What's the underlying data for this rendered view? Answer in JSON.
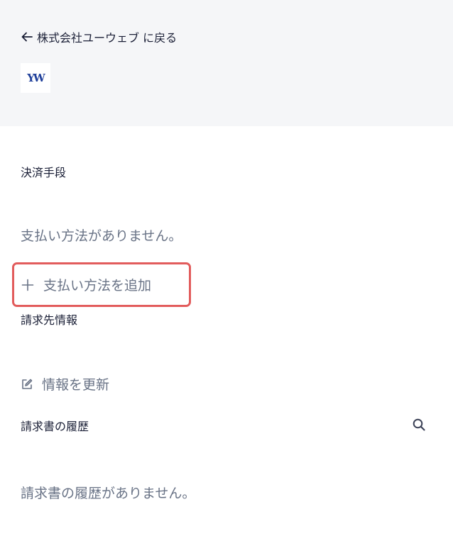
{
  "header": {
    "back_label": "株式会社ユーウェブ に戻る",
    "logo_text": "YW",
    "logo_color": "#1f3f9a",
    "background": "#f5f6f8"
  },
  "payment": {
    "heading": "決済手段",
    "empty_text": "支払い方法がありません。",
    "add_label": "支払い方法を追加",
    "highlight_color": "#e25c5c"
  },
  "billing": {
    "heading": "請求先情報",
    "update_label": "情報を更新"
  },
  "invoices": {
    "heading": "請求書の履歴",
    "empty_text": "請求書の履歴がありません。"
  },
  "icons": {
    "back": "arrow-left-icon",
    "add": "plus-icon",
    "edit": "edit-icon",
    "search": "search-icon"
  }
}
